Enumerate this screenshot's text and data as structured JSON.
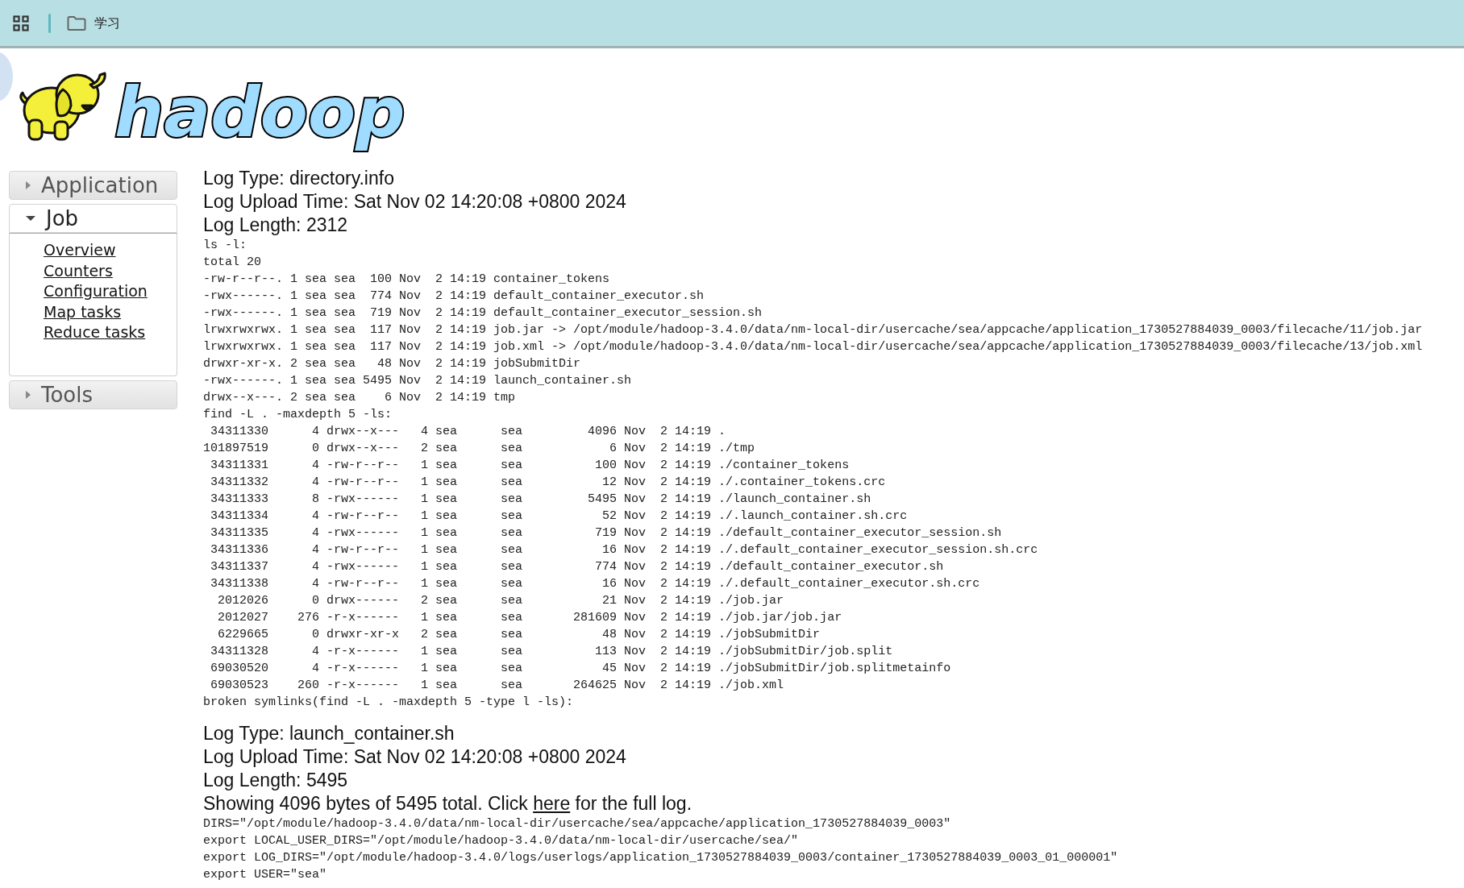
{
  "toolbar": {
    "folder": "学习"
  },
  "logo": {
    "text": "hadoop"
  },
  "sidebar": [
    {
      "label": "Application",
      "expanded": false
    },
    {
      "label": "Job",
      "expanded": true,
      "links": [
        "Overview",
        "Counters",
        "Configuration",
        "Map tasks",
        "Reduce tasks"
      ]
    },
    {
      "label": "Tools",
      "expanded": false
    }
  ],
  "logs": [
    {
      "type_line": "Log Type: directory.info",
      "upload_line": "Log Upload Time: Sat Nov 02 14:20:08 +0800 2024",
      "length_line": "Log Length: 2312",
      "lines": [
        "ls -l:",
        "total 20",
        "-rw-r--r--. 1 sea sea  100 Nov  2 14:19 container_tokens",
        "-rwx------. 1 sea sea  774 Nov  2 14:19 default_container_executor.sh",
        "-rwx------. 1 sea sea  719 Nov  2 14:19 default_container_executor_session.sh",
        "lrwxrwxrwx. 1 sea sea  117 Nov  2 14:19 job.jar -> /opt/module/hadoop-3.4.0/data/nm-local-dir/usercache/sea/appcache/application_1730527884039_0003/filecache/11/job.jar",
        "lrwxrwxrwx. 1 sea sea  117 Nov  2 14:19 job.xml -> /opt/module/hadoop-3.4.0/data/nm-local-dir/usercache/sea/appcache/application_1730527884039_0003/filecache/13/job.xml",
        "drwxr-xr-x. 2 sea sea   48 Nov  2 14:19 jobSubmitDir",
        "-rwx------. 1 sea sea 5495 Nov  2 14:19 launch_container.sh",
        "drwx--x---. 2 sea sea    6 Nov  2 14:19 tmp",
        "find -L . -maxdepth 5 -ls:",
        " 34311330      4 drwx--x---   4 sea      sea         4096 Nov  2 14:19 .",
        "101897519      0 drwx--x---   2 sea      sea            6 Nov  2 14:19 ./tmp",
        " 34311331      4 -rw-r--r--   1 sea      sea          100 Nov  2 14:19 ./container_tokens",
        " 34311332      4 -rw-r--r--   1 sea      sea           12 Nov  2 14:19 ./.container_tokens.crc",
        " 34311333      8 -rwx------   1 sea      sea         5495 Nov  2 14:19 ./launch_container.sh",
        " 34311334      4 -rw-r--r--   1 sea      sea           52 Nov  2 14:19 ./.launch_container.sh.crc",
        " 34311335      4 -rwx------   1 sea      sea          719 Nov  2 14:19 ./default_container_executor_session.sh",
        " 34311336      4 -rw-r--r--   1 sea      sea           16 Nov  2 14:19 ./.default_container_executor_session.sh.crc",
        " 34311337      4 -rwx------   1 sea      sea          774 Nov  2 14:19 ./default_container_executor.sh",
        " 34311338      4 -rw-r--r--   1 sea      sea           16 Nov  2 14:19 ./.default_container_executor.sh.crc",
        "  2012026      0 drwx------   2 sea      sea           21 Nov  2 14:19 ./job.jar",
        "  2012027    276 -r-x------   1 sea      sea       281609 Nov  2 14:19 ./job.jar/job.jar",
        "  6229665      0 drwxr-xr-x   2 sea      sea           48 Nov  2 14:19 ./jobSubmitDir",
        " 34311328      4 -r-x------   1 sea      sea          113 Nov  2 14:19 ./jobSubmitDir/job.split",
        " 69030520      4 -r-x------   1 sea      sea           45 Nov  2 14:19 ./jobSubmitDir/job.splitmetainfo",
        " 69030523    260 -r-x------   1 sea      sea       264625 Nov  2 14:19 ./job.xml",
        "broken symlinks(find -L . -maxdepth 5 -type l -ls):"
      ]
    },
    {
      "type_line": "Log Type: launch_container.sh",
      "upload_line": "Log Upload Time: Sat Nov 02 14:20:08 +0800 2024",
      "length_line": "Log Length: 5495",
      "notice": {
        "before": "Showing 4096 bytes of 5495 total. Click ",
        "link": "here",
        "after": " for the full log."
      },
      "lines": [
        "DIRS=\"/opt/module/hadoop-3.4.0/data/nm-local-dir/usercache/sea/appcache/application_1730527884039_0003\"",
        "export LOCAL_USER_DIRS=\"/opt/module/hadoop-3.4.0/data/nm-local-dir/usercache/sea/\"",
        "export LOG_DIRS=\"/opt/module/hadoop-3.4.0/logs/userlogs/application_1730527884039_0003/container_1730527884039_0003_01_000001\"",
        "export USER=\"sea\""
      ]
    }
  ]
}
